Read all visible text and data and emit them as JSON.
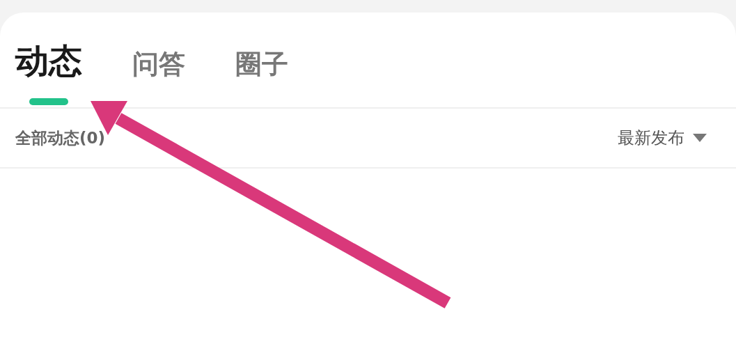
{
  "tabs": [
    {
      "label": "动态",
      "selected": true
    },
    {
      "label": "问答",
      "selected": false
    },
    {
      "label": "圈子",
      "selected": false
    }
  ],
  "filter": {
    "label": "全部动态(0)"
  },
  "sort": {
    "label": "最新发布"
  }
}
